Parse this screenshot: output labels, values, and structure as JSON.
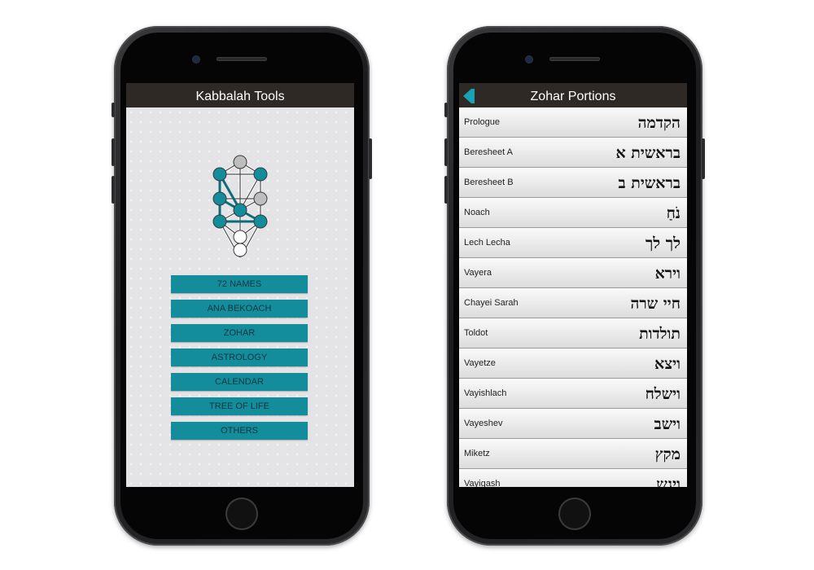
{
  "left_phone": {
    "title": "Kabbalah Tools",
    "menu": [
      "72 NAMES",
      "ANA BEKOACH",
      "ZOHAR",
      "ASTROLOGY",
      "CALENDAR",
      "TREE OF LIFE",
      "OTHERS"
    ]
  },
  "right_phone": {
    "title": "Zohar Portions",
    "rows": [
      {
        "en": "Prologue",
        "he": "הקדמה"
      },
      {
        "en": "Beresheet A",
        "he": "בראשית א"
      },
      {
        "en": "Beresheet B",
        "he": "בראשית ב"
      },
      {
        "en": "Noach",
        "he": "נֹחַ"
      },
      {
        "en": "Lech Lecha",
        "he": "לך לך"
      },
      {
        "en": "Vayera",
        "he": "וירא"
      },
      {
        "en": "Chayei Sarah",
        "he": "חיי שרה"
      },
      {
        "en": "Toldot",
        "he": "תולדות"
      },
      {
        "en": "Vayetze",
        "he": "ויצא"
      },
      {
        "en": "Vayishlach",
        "he": "וישלח"
      },
      {
        "en": "Vayeshev",
        "he": "וישב"
      },
      {
        "en": "Miketz",
        "he": "מקץ"
      },
      {
        "en": "Vayigash",
        "he": "ויגש"
      }
    ]
  },
  "colors": {
    "accent": "#138c9c",
    "navbar": "#2f2925",
    "tree_node_gray": "#bdbdbd",
    "tree_node_white": "#ffffff"
  },
  "icons": [
    "back-arrow-icon",
    "tree-of-life-icon"
  ]
}
